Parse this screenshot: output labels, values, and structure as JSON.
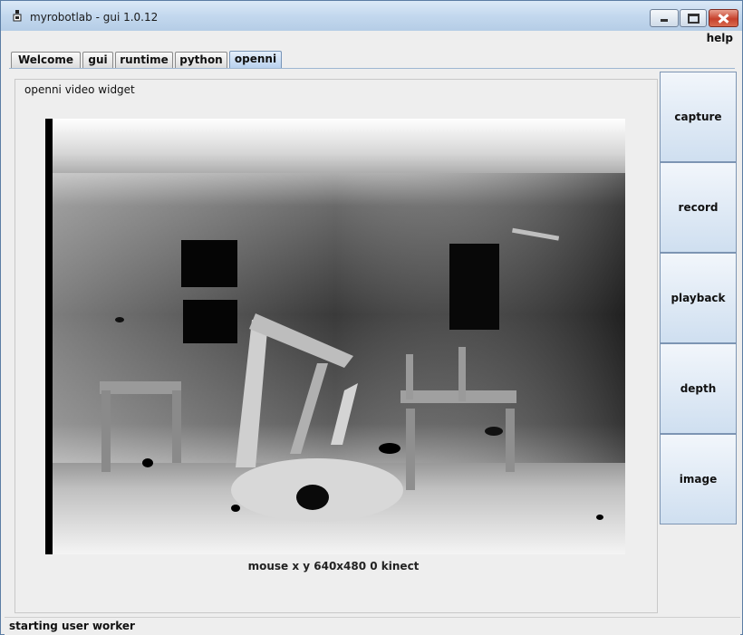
{
  "window": {
    "title": "myrobotlab - gui 1.0.12"
  },
  "menu": {
    "help": "help"
  },
  "tabs": [
    {
      "label": "Welcome"
    },
    {
      "label": "gui"
    },
    {
      "label": "runtime"
    },
    {
      "label": "python"
    },
    {
      "label": "openni",
      "active": true
    }
  ],
  "widget": {
    "label": "openni  video widget",
    "info": "mouse x y  640x480  0  kinect"
  },
  "buttons": [
    {
      "label": "capture"
    },
    {
      "label": "record"
    },
    {
      "label": "playback"
    },
    {
      "label": "depth"
    },
    {
      "label": "image"
    }
  ],
  "status": "starting user worker",
  "icons": {
    "app": "robot-icon",
    "minimize": "minimize-icon",
    "maximize": "maximize-icon",
    "close": "close-icon"
  }
}
